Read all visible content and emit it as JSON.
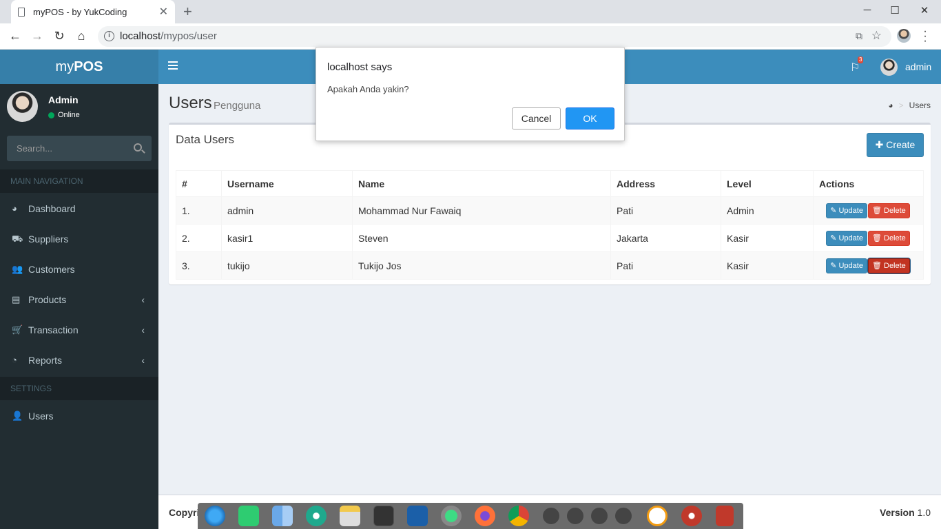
{
  "browser": {
    "tab_title": "myPOS - by YukCoding",
    "url_host": "localhost",
    "url_path": "/mypos/user"
  },
  "app": {
    "logo_my": "my",
    "logo_pos": "POS",
    "navbar_username": "admin",
    "notif_count": "3"
  },
  "sidebar": {
    "user_name": "Admin",
    "user_status": "Online",
    "search_placeholder": "Search...",
    "section_main": "MAIN NAVIGATION",
    "section_settings": "SETTINGS",
    "items": [
      {
        "label": "Dashboard",
        "icon": "dashboard-icon"
      },
      {
        "label": "Suppliers",
        "icon": "truck-icon"
      },
      {
        "label": "Customers",
        "icon": "users-icon"
      },
      {
        "label": "Products",
        "icon": "archive-icon"
      },
      {
        "label": "Transaction",
        "icon": "cart-icon"
      },
      {
        "label": "Reports",
        "icon": "pie-chart-icon"
      },
      {
        "label": "Users",
        "icon": "user-icon"
      }
    ]
  },
  "content": {
    "title": "Users",
    "subtitle": "Pengguna",
    "breadcrumb_current": "Users",
    "box_title": "Data Users",
    "create_label": "Create",
    "table": {
      "headers": [
        "#",
        "Username",
        "Name",
        "Address",
        "Level",
        "Actions"
      ],
      "rows": [
        {
          "no": "1.",
          "username": "admin",
          "name": "Mohammad Nur Fawaiq",
          "address": "Pati",
          "level": "Admin"
        },
        {
          "no": "2.",
          "username": "kasir1",
          "name": "Steven",
          "address": "Jakarta",
          "level": "Kasir"
        },
        {
          "no": "3.",
          "username": "tukijo",
          "name": "Tukijo Jos",
          "address": "Pati",
          "level": "Kasir"
        }
      ],
      "update_label": "Update",
      "delete_label": "Delete"
    }
  },
  "footer": {
    "left": "Copyri",
    "version_label": "Version",
    "version_value": "1.0"
  },
  "dialog": {
    "title": "localhost says",
    "message": "Apakah Anda yakin?",
    "cancel_label": "Cancel",
    "ok_label": "OK"
  },
  "colors": {
    "navbar": "#3c8dbc",
    "logo_bg": "#367fa9",
    "sidebar_bg": "#222d32",
    "danger": "#dd4b39",
    "dialog_ok": "#2196f3"
  }
}
